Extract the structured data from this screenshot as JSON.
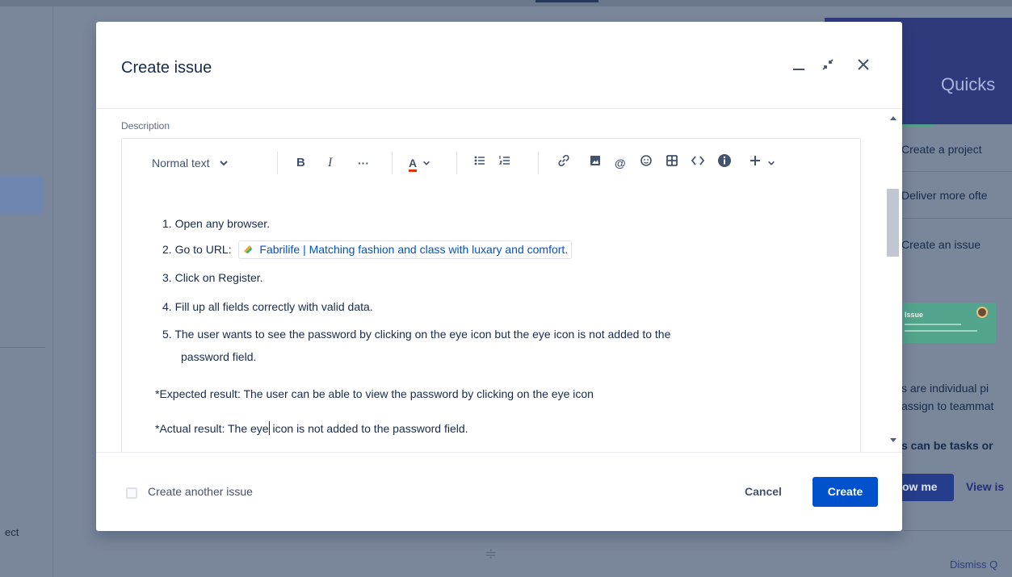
{
  "background": {
    "left_truncated_text": "ect",
    "quickstart_title": "Quicks",
    "quickstart_items": [
      "Create a project",
      "Deliver more ofte",
      "Create an issue"
    ],
    "card_title": "Issue",
    "paragraph_lines": [
      "s are individual pi",
      "assign to teammat"
    ],
    "paragraph_bold": "s can be tasks or",
    "show_me_label": "ow me",
    "view_issues_label": "View is",
    "dismiss_label": "Dismiss Q",
    "resize_handle_glyph": "≑"
  },
  "modal": {
    "title": "Create issue",
    "minimize_glyph": "—",
    "shrink_glyph": "↙↗",
    "close_glyph": "✕",
    "description_label": "Description",
    "toolbar": {
      "text_style": "Normal text",
      "bold": "B",
      "italic": "I",
      "more": "···",
      "text_color": "A",
      "bullet_list": "☰",
      "numbered_list": "☰",
      "link": "🔗",
      "image": "▣",
      "mention": "@",
      "emoji": "☺",
      "table": "⊞",
      "code": "<>",
      "info": "i",
      "insert": "+"
    },
    "steps": [
      {
        "num": "1.",
        "text": "Open any browser."
      },
      {
        "num": "2.",
        "text": "Go to URL: ",
        "link_text": "Fabrilife | Matching fashion and class with luxary and comfort."
      },
      {
        "num": "3.",
        "text": "Click on Register."
      },
      {
        "num": "4.",
        "text": "Fill up all fields correctly with valid data."
      },
      {
        "num": "5.",
        "text": " The user wants to see the password by clicking on the eye icon but the eye icon is not added to the",
        "continuation": "password field."
      }
    ],
    "expected": "*Expected result: The user can be able to view the password by clicking on the eye icon",
    "actual_before_caret": "*Actual result: The eye",
    "actual_after_caret": " icon is not added to the password field.",
    "create_another_label": "Create another issue",
    "cancel_label": "Cancel",
    "create_label": "Create"
  },
  "colors": {
    "primary": "#0052cc",
    "link": "#0052cc",
    "overlay": "#7a869a"
  }
}
